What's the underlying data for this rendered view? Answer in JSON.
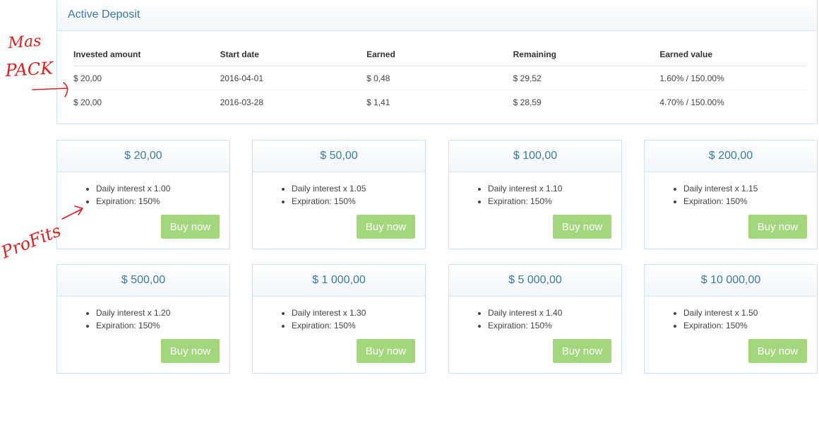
{
  "deposit": {
    "title": "Active Deposit",
    "columns": [
      "Invested amount",
      "Start date",
      "Earned",
      "Remaining",
      "Earned value"
    ],
    "rows": [
      [
        "$ 20,00",
        "2016-04-01",
        "$ 0,48",
        "$ 29,52",
        "1.60% / 150.00%"
      ],
      [
        "$ 20,00",
        "2016-03-28",
        "$ 1,41",
        "$ 28,59",
        "4.70% / 150.00%"
      ]
    ]
  },
  "packs": [
    {
      "price": "$ 20,00",
      "interest": "Daily interest x 1.00",
      "expiration": "Expiration: 150%",
      "button": "Buy now"
    },
    {
      "price": "$ 50,00",
      "interest": "Daily interest x 1.05",
      "expiration": "Expiration: 150%",
      "button": "Buy now"
    },
    {
      "price": "$ 100,00",
      "interest": "Daily interest x 1.10",
      "expiration": "Expiration: 150%",
      "button": "Buy now"
    },
    {
      "price": "$ 200,00",
      "interest": "Daily interest x 1.15",
      "expiration": "Expiration: 150%",
      "button": "Buy now"
    },
    {
      "price": "$ 500,00",
      "interest": "Daily interest x 1.20",
      "expiration": "Expiration: 150%",
      "button": "Buy now"
    },
    {
      "price": "$ 1 000,00",
      "interest": "Daily interest x 1.30",
      "expiration": "Expiration: 150%",
      "button": "Buy now"
    },
    {
      "price": "$ 5 000,00",
      "interest": "Daily interest x 1.40",
      "expiration": "Expiration: 150%",
      "button": "Buy now"
    },
    {
      "price": "$ 10 000,00",
      "interest": "Daily interest x 1.50",
      "expiration": "Expiration: 150%",
      "button": "Buy now"
    }
  ],
  "annotations": {
    "pack_note": "Mas PACK",
    "profits_note": "ProFits",
    "ink_color": "#e0201b"
  },
  "colors": {
    "accent": "#3b7aa3",
    "button": "#a3d77c",
    "border": "#cfe1ec"
  }
}
